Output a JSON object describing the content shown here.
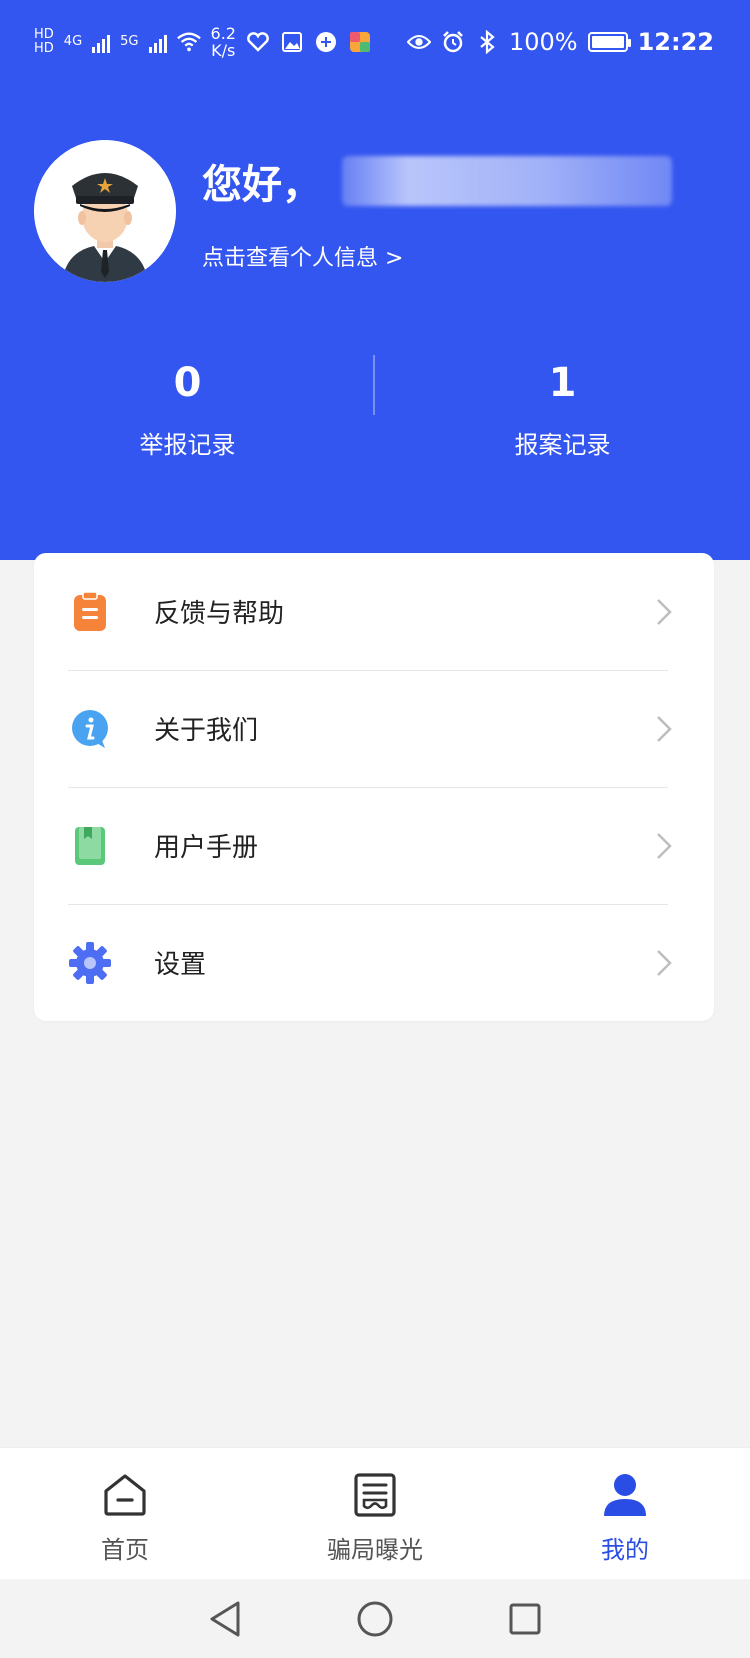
{
  "status_bar": {
    "hd1": "HD",
    "hd2": "HD",
    "net1": "4G",
    "net2": "5G",
    "speed_value": "6.2",
    "speed_unit": "K/s",
    "battery_pct": "100%",
    "time": "12:22"
  },
  "profile": {
    "greeting": "您好，",
    "link": "点击查看个人信息 >"
  },
  "stats": [
    {
      "value": "0",
      "label": "举报记录"
    },
    {
      "value": "1",
      "label": "报案记录"
    }
  ],
  "menu": [
    {
      "label": "反馈与帮助",
      "icon": "clipboard-icon",
      "color": "#f5833a"
    },
    {
      "label": "关于我们",
      "icon": "info-bubble-icon",
      "color": "#4aa3f0"
    },
    {
      "label": "用户手册",
      "icon": "book-icon",
      "color": "#5cc87a"
    },
    {
      "label": "设置",
      "icon": "gear-icon",
      "color": "#4d6df2"
    }
  ],
  "bottom_nav": [
    {
      "label": "首页",
      "icon": "home-icon"
    },
    {
      "label": "骗局曝光",
      "icon": "news-icon"
    },
    {
      "label": "我的",
      "icon": "user-icon",
      "active": true
    }
  ],
  "colors": {
    "primary": "#3355f0",
    "active_tab": "#2a4de6"
  }
}
